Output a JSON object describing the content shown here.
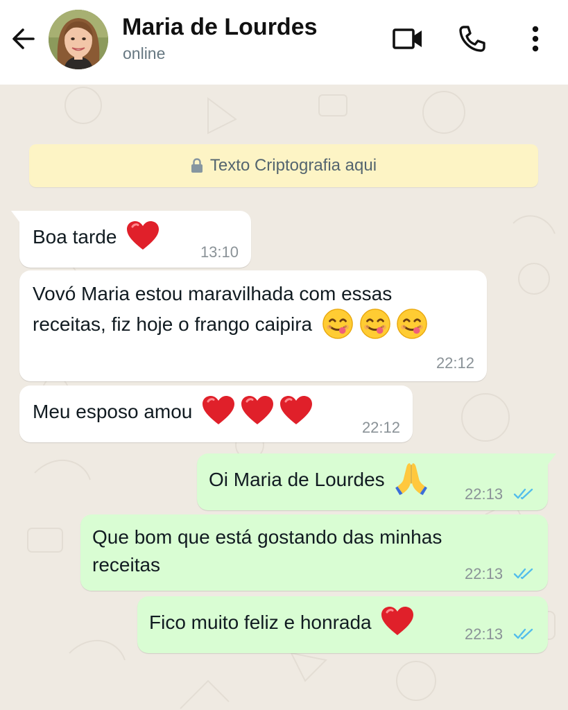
{
  "header": {
    "contact_name": "Maria de Lourdes",
    "status": "online"
  },
  "encryption_banner": {
    "text": "Texto Criptografia aqui"
  },
  "messages": [
    {
      "direction": "incoming",
      "text": "Boa tarde",
      "emoji": "red-heart",
      "time": "13:10"
    },
    {
      "direction": "incoming",
      "lines": [
        "Vovó Maria estou maravilhada com essas",
        "receitas, fiz hoje o frango caipira"
      ],
      "emoji": "yum-face x3",
      "time": "22:12"
    },
    {
      "direction": "incoming",
      "text": "Meu esposo amou",
      "emoji": "red-heart x3",
      "time": "22:12"
    },
    {
      "direction": "outgoing",
      "text": "Oi Maria de Lourdes",
      "emoji": "folded-hands",
      "time": "22:13",
      "status": "read"
    },
    {
      "direction": "outgoing",
      "lines": [
        "Que bom que está gostando das minhas",
        "receitas"
      ],
      "time": "22:13",
      "status": "read"
    },
    {
      "direction": "outgoing",
      "text": "Fico muito feliz e honrada",
      "emoji": "red-heart",
      "time": "22:13",
      "status": "read"
    }
  ],
  "colors": {
    "chat_background": "#efeae2",
    "incoming_bubble": "#ffffff",
    "outgoing_bubble": "#d9fdd3",
    "banner": "#fdf4c5",
    "read_ticks": "#53bdeb"
  }
}
